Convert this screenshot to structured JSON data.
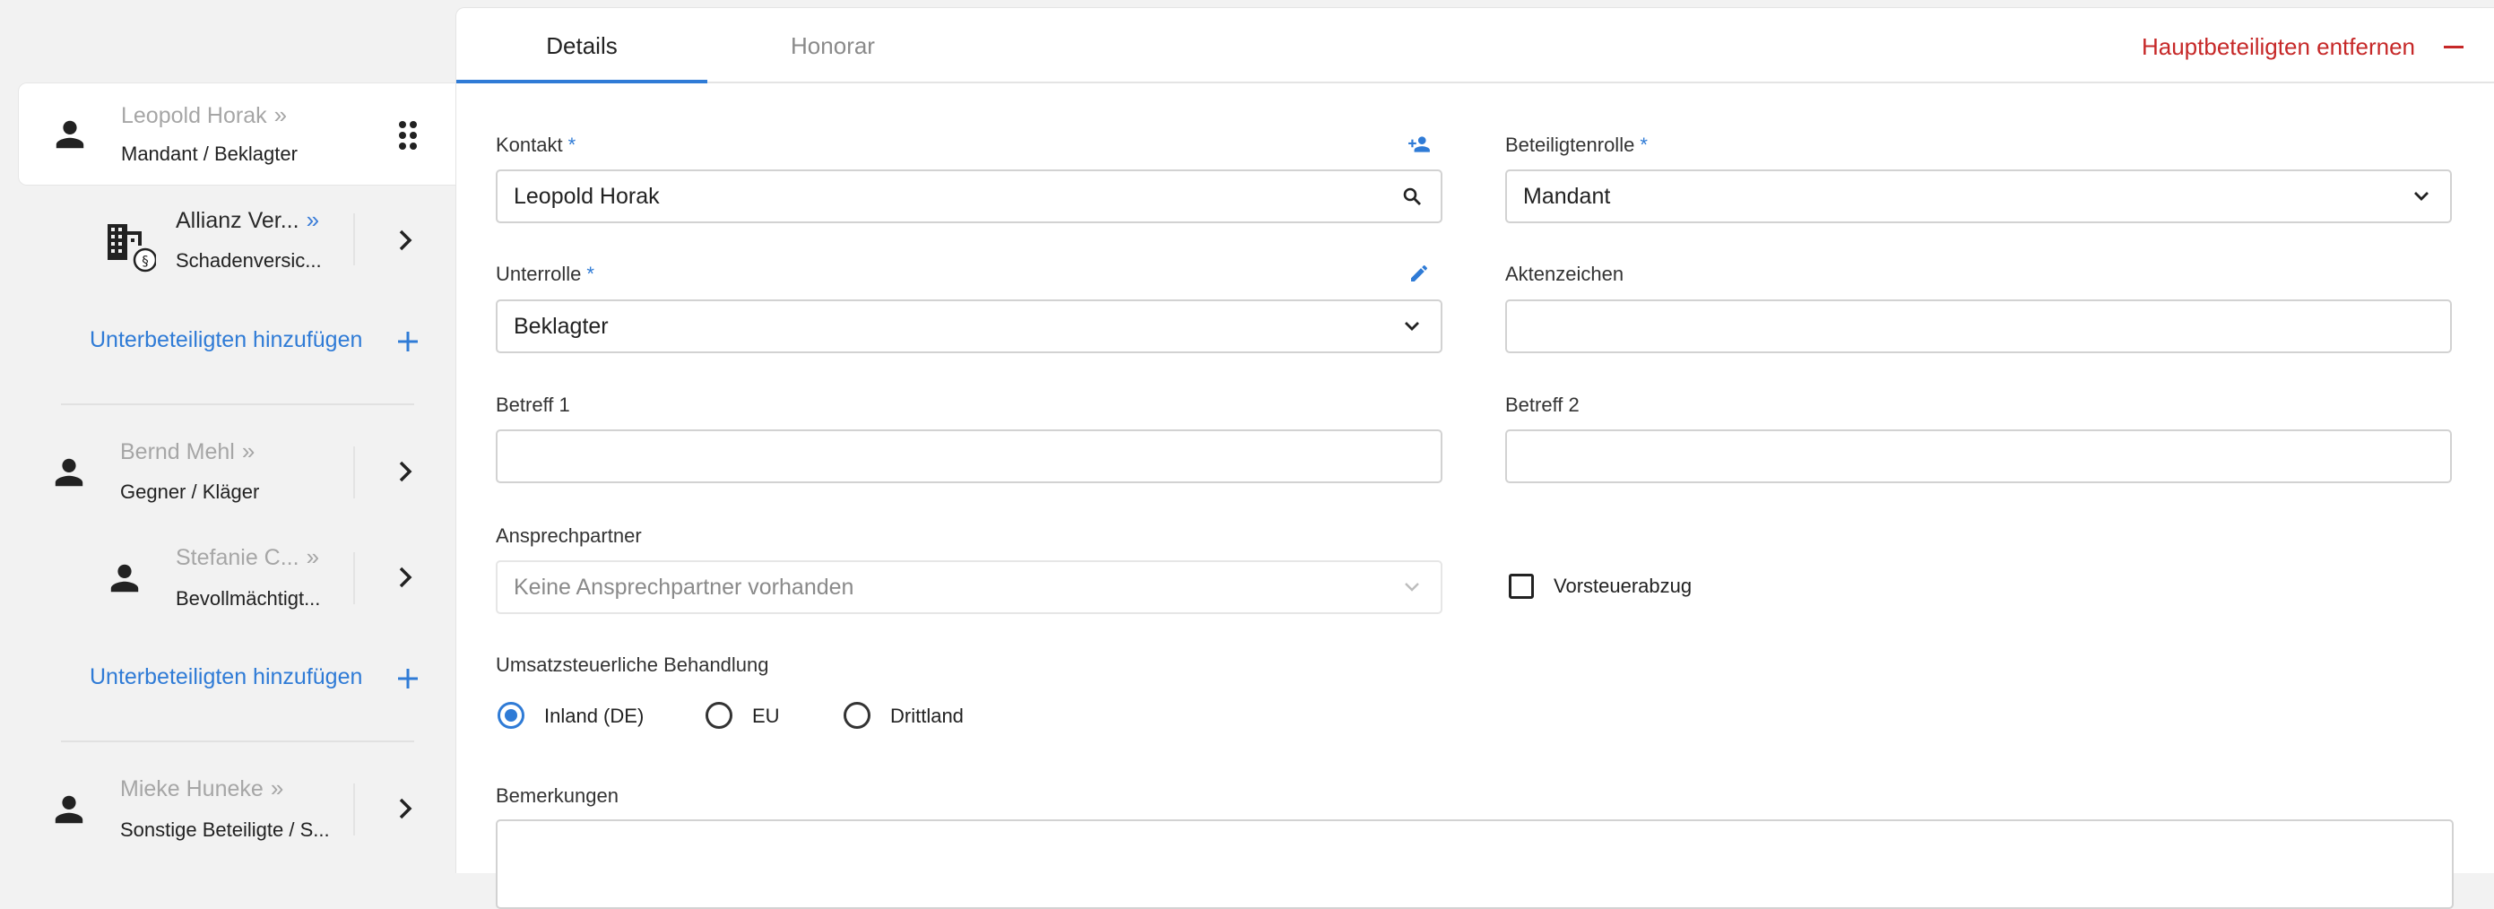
{
  "sidebar": {
    "parties": [
      {
        "name": "Leopold Horak",
        "raquo": "»",
        "role": "Mandant / Beklagter",
        "icon": "person-icon",
        "subparties": [
          {
            "name": "Allianz Ver...",
            "raquo": "»",
            "role": "Schadenversic...",
            "icon": "insurance-building-icon"
          }
        ],
        "add_sub_label": "Unterbeteiligten hinzufügen"
      },
      {
        "name": "Bernd Mehl",
        "raquo": "»",
        "role": "Gegner / Kläger",
        "icon": "person-icon",
        "subparties": [
          {
            "name": "Stefanie C...",
            "raquo": "»",
            "role": "Bevollmächtigt...",
            "icon": "person-icon"
          }
        ],
        "add_sub_label": "Unterbeteiligten hinzufügen"
      },
      {
        "name": "Mieke Huneke",
        "raquo": "»",
        "role": "Sonstige Beteiligte / S...",
        "icon": "person-icon"
      }
    ]
  },
  "tabs": [
    {
      "label": "Details",
      "active": true
    },
    {
      "label": "Honorar",
      "active": false
    }
  ],
  "header": {
    "remove_main_label": "Hauptbeteiligten entfernen"
  },
  "form": {
    "required_marker": "*",
    "kontakt": {
      "label": "Kontakt",
      "value": "Leopold Horak"
    },
    "beteiligtenrolle": {
      "label": "Beteiligtenrolle",
      "value": "Mandant"
    },
    "unterrolle": {
      "label": "Unterrolle",
      "value": "Beklagter"
    },
    "aktenzeichen": {
      "label": "Aktenzeichen",
      "value": ""
    },
    "betreff1": {
      "label": "Betreff 1",
      "value": ""
    },
    "betreff2": {
      "label": "Betreff 2",
      "value": ""
    },
    "ansprechpartner": {
      "label": "Ansprechpartner",
      "value": "Keine Ansprechpartner vorhanden"
    },
    "vorsteuerabzug": {
      "label": "Vorsteuerabzug",
      "checked": false
    },
    "ust": {
      "label": "Umsatzsteuerliche Behandlung",
      "options": [
        "Inland (DE)",
        "EU",
        "Drittland"
      ],
      "selected": "Inland (DE)"
    },
    "bemerkungen": {
      "label": "Bemerkungen",
      "value": ""
    }
  },
  "colors": {
    "accent": "#2f7bd6",
    "danger": "#c62828"
  }
}
